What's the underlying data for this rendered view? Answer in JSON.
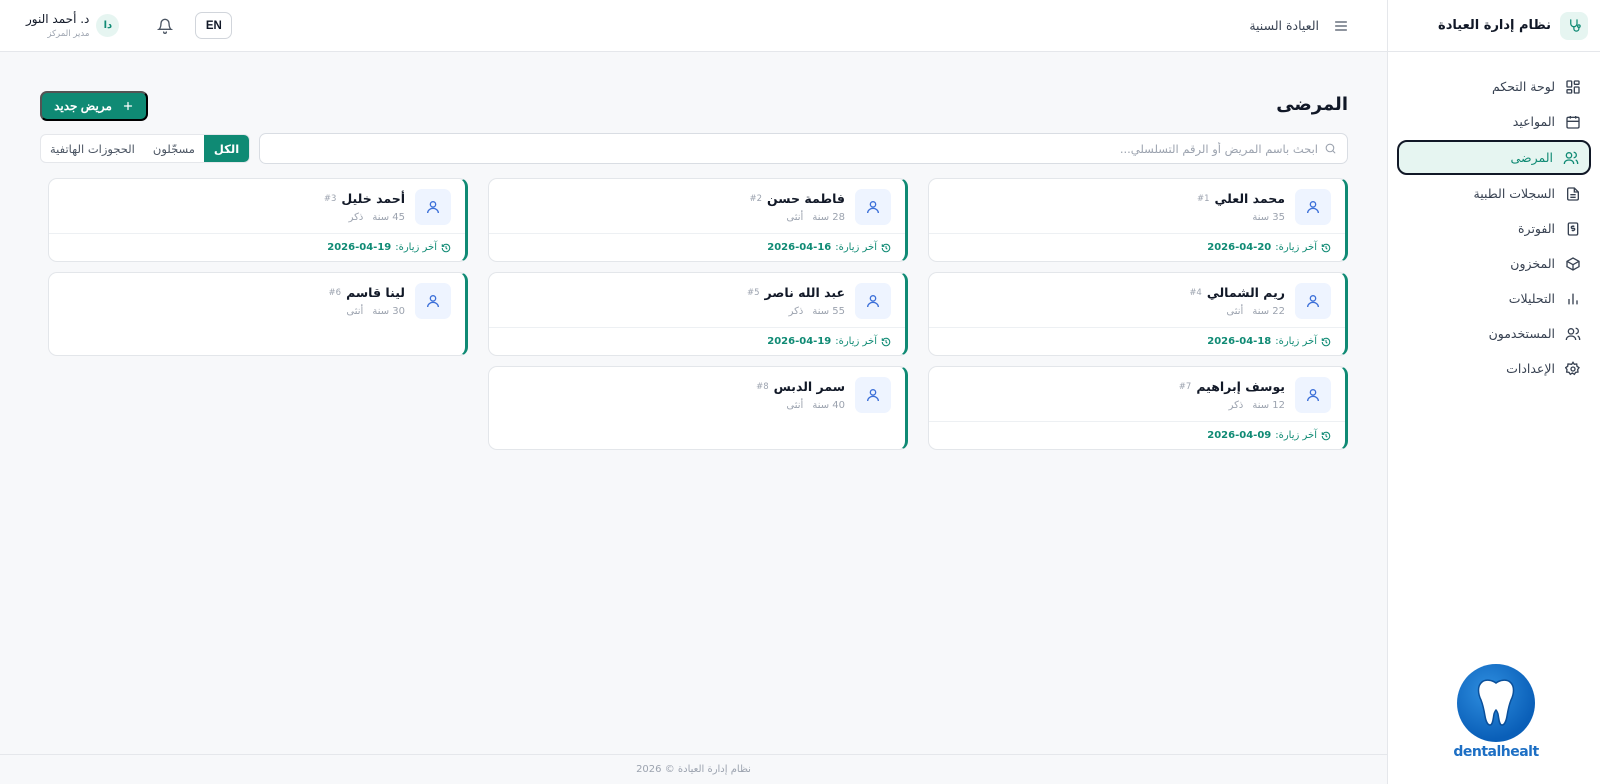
{
  "app": {
    "title": "نظام إدارة العيادة"
  },
  "sidebar": {
    "items": [
      {
        "label": "لوحة التحكم",
        "icon": "dashboard-icon"
      },
      {
        "label": "المواعيد",
        "icon": "calendar-icon"
      },
      {
        "label": "المرضى",
        "icon": "users-icon",
        "active": true
      },
      {
        "label": "السجلات الطبية",
        "icon": "document-icon"
      },
      {
        "label": "الفوترة",
        "icon": "dollar-icon"
      },
      {
        "label": "المخزون",
        "icon": "box-icon"
      },
      {
        "label": "التحليلات",
        "icon": "bar-chart-icon"
      },
      {
        "label": "المستخدمون",
        "icon": "users-icon"
      },
      {
        "label": "الإعدادات",
        "icon": "gear-icon"
      }
    ],
    "logo_text": "dentalhealt"
  },
  "header": {
    "clinic_name": "العيادة السنية",
    "lang_button": "EN",
    "user_name": "د. أحمد النور",
    "user_role": "مدير المركز",
    "avatar_initials": "دا"
  },
  "main": {
    "page_title": "المرضى",
    "new_patient_button": "مريض جديد",
    "search_placeholder": "ابحث باسم المريض أو الرقم التسلسلي...",
    "filters": [
      {
        "label": "الكل",
        "active": true
      },
      {
        "label": "مسجّلون",
        "active": false
      },
      {
        "label": "الحجوزات الهاتفية",
        "active": false
      }
    ],
    "last_visit_label": "آخر زيارة:",
    "patients": [
      {
        "name": "محمد العلي",
        "id": "#1",
        "age": "35 سنة",
        "gender": "",
        "last_visit": "2026-04-20"
      },
      {
        "name": "فاطمة حسن",
        "id": "#2",
        "age": "28 سنة",
        "gender": "أنثى",
        "last_visit": "2026-04-16"
      },
      {
        "name": "أحمد خليل",
        "id": "#3",
        "age": "45 سنة",
        "gender": "ذكر",
        "last_visit": "2026-04-19"
      },
      {
        "name": "ريم الشمالي",
        "id": "#4",
        "age": "22 سنة",
        "gender": "أنثى",
        "last_visit": "2026-04-18"
      },
      {
        "name": "عبد الله ناصر",
        "id": "#5",
        "age": "55 سنة",
        "gender": "ذكر",
        "last_visit": "2026-04-19"
      },
      {
        "name": "لينا قاسم",
        "id": "#6",
        "age": "30 سنة",
        "gender": "أنثى",
        "last_visit": ""
      },
      {
        "name": "يوسف إبراهيم",
        "id": "#7",
        "age": "12 سنة",
        "gender": "ذكر",
        "last_visit": "2026-04-09"
      },
      {
        "name": "سمر الدبس",
        "id": "#8",
        "age": "40 سنة",
        "gender": "أنثى",
        "last_visit": ""
      }
    ]
  },
  "footer": {
    "text": "نظام إدارة العيادة © 2026"
  },
  "colors": {
    "accent": "#0f8a74",
    "accent_light": "#e6f5f1",
    "icon_bg": "#eef4ff",
    "icon_blue": "#3b6fd8"
  }
}
